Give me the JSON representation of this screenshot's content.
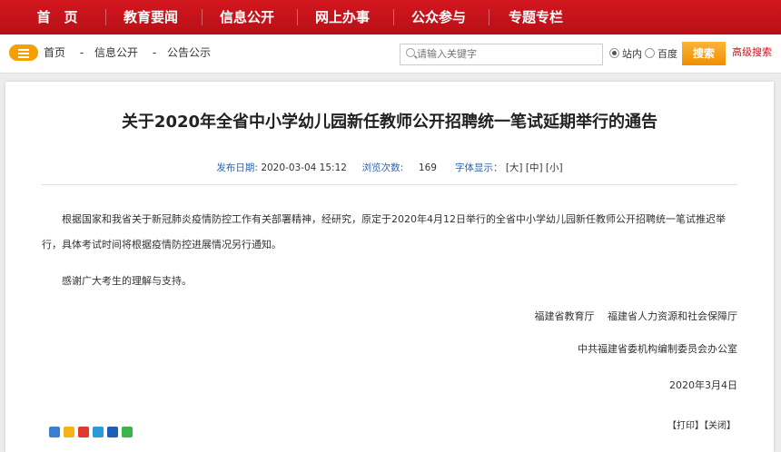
{
  "nav": {
    "items": [
      {
        "label": "首　页"
      },
      {
        "label": "教育要闻"
      },
      {
        "label": "信息公开"
      },
      {
        "label": "网上办事"
      },
      {
        "label": "公众参与"
      },
      {
        "label": "专题专栏"
      }
    ]
  },
  "breadcrumb": {
    "items": [
      "首页",
      "-",
      "信息公开",
      "-",
      "公告公示"
    ]
  },
  "search": {
    "placeholder": "请输入关键字",
    "options": [
      {
        "label": "站内",
        "selected": true
      },
      {
        "label": "百度",
        "selected": false
      }
    ],
    "button_label": "搜索",
    "advanced_label": "高级搜索"
  },
  "article": {
    "title": "关于2020年全省中小学幼儿园新任教师公开招聘统一笔试延期举行的通告",
    "meta": {
      "date_label": "发布日期:",
      "date": "2020-03-04 15:12",
      "views_label": "浏览次数:",
      "views": "169",
      "font_label": "字体显示：",
      "font_options": "[大] [中] [小]"
    },
    "paragraphs": [
      "根据国家和我省关于新冠肺炎疫情防控工作有关部署精神，经研究，原定于2020年4月12日举行的全省中小学幼儿园新任教师公开招聘统一笔试推迟举行，具体考试时间将根据疫情防控进展情况另行通知。",
      "感谢广大考生的理解与支持。"
    ],
    "signature": {
      "line1": "福建省教育厅　 福建省人力资源和社会保障厅",
      "line2": "中共福建省委机构编制委员会办公室",
      "date": "2020年3月4日"
    },
    "actions": {
      "print": "【打印】",
      "close": "【关闭】"
    }
  },
  "colors": {
    "nav_bg": "#c8141b",
    "accent_orange": "#f5a000",
    "meta_blue": "#2a64ad"
  }
}
